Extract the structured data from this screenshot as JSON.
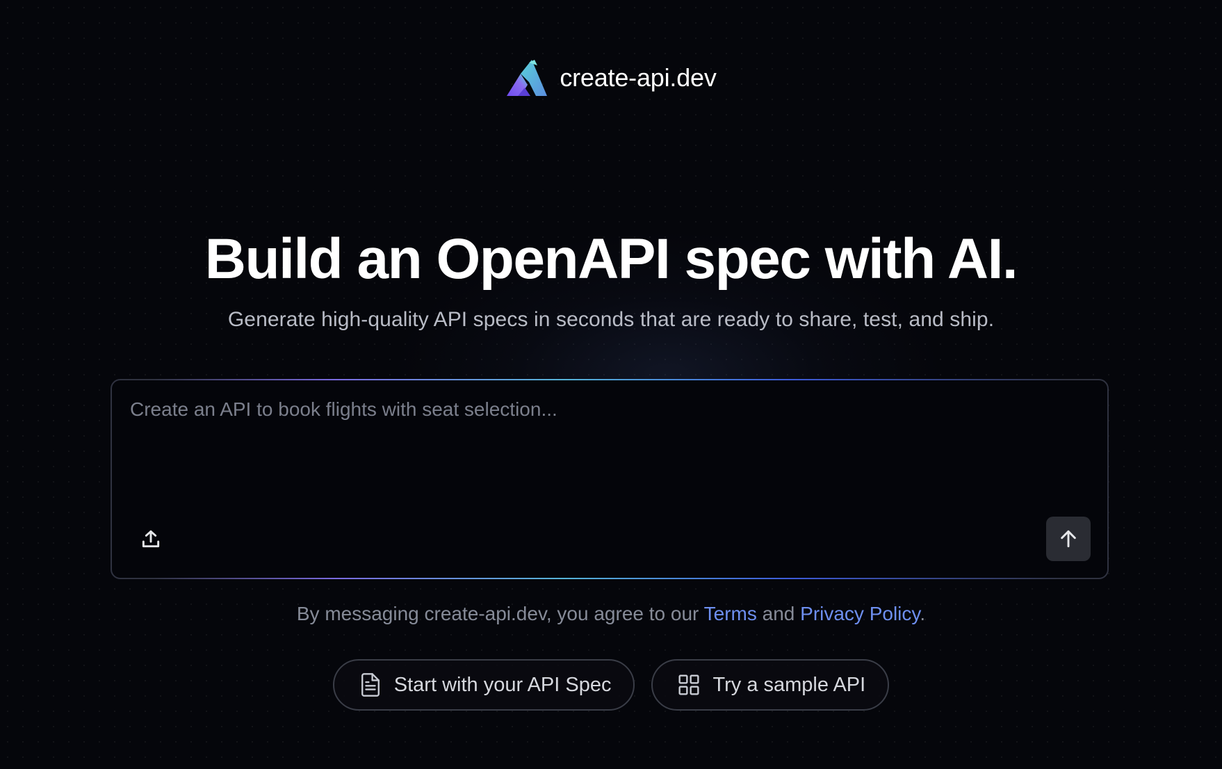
{
  "brand": {
    "name": "create-api.dev",
    "logo_icon": "mountain-logo-icon"
  },
  "hero": {
    "title": "Build an OpenAPI spec with AI.",
    "subtitle": "Generate high-quality API specs in seconds that are ready to share, test, and ship."
  },
  "prompt": {
    "placeholder": "Create an API to book flights with seat selection...",
    "value": "",
    "upload_icon": "upload-icon",
    "send_icon": "arrow-up-icon"
  },
  "legal": {
    "prefix": "By messaging create-api.dev, you agree to our ",
    "terms_label": "Terms",
    "middle": " and ",
    "privacy_label": "Privacy Policy",
    "suffix": "."
  },
  "actions": {
    "start_spec_label": "Start with your API Spec",
    "start_spec_icon": "document-icon",
    "sample_label": "Try a sample API",
    "sample_icon": "grid-icon"
  },
  "colors": {
    "background": "#05060b",
    "link": "#6e8ff0",
    "accent_purple": "#7a6be0",
    "accent_cyan": "#56b4d8",
    "accent_blue": "#3d5bd9"
  }
}
